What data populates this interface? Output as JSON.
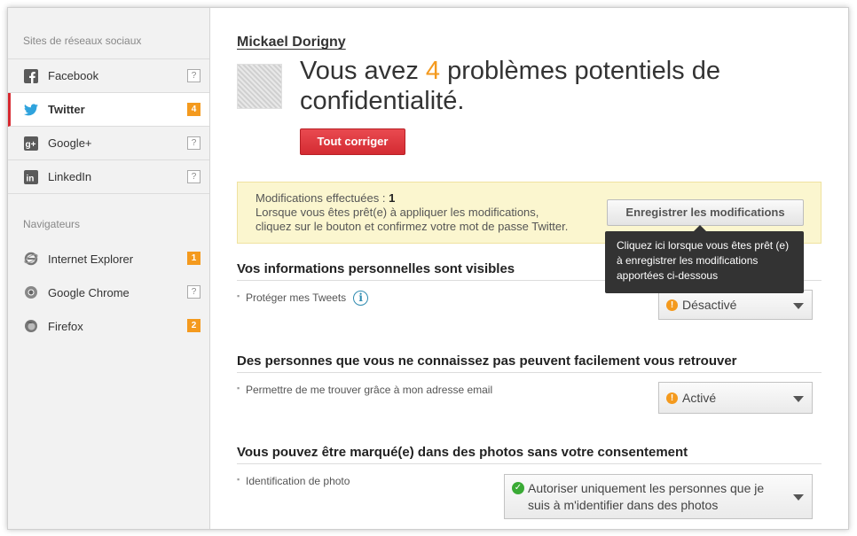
{
  "sidebar": {
    "social_heading": "Sites de réseaux sociaux",
    "social_items": [
      {
        "label": "Facebook",
        "badge": "?",
        "icon": "facebook-icon"
      },
      {
        "label": "Twitter",
        "badge": "4",
        "icon": "twitter-icon",
        "active": true
      },
      {
        "label": "Google+",
        "badge": "?",
        "icon": "google-plus-icon"
      },
      {
        "label": "LinkedIn",
        "badge": "?",
        "icon": "linkedin-icon"
      }
    ],
    "browser_heading": "Navigateurs",
    "browser_items": [
      {
        "label": "Internet Explorer",
        "badge": "1",
        "icon": "internet-explorer-icon"
      },
      {
        "label": "Google Chrome",
        "badge": "?",
        "icon": "google-chrome-icon"
      },
      {
        "label": "Firefox",
        "badge": "2",
        "icon": "firefox-icon"
      }
    ]
  },
  "header": {
    "user_name": "Mickael Dorigny",
    "headline_pre": "Vous avez ",
    "headline_count": "4",
    "headline_post": " problèmes potentiels de confidentialité.",
    "fix_all_label": "Tout corriger"
  },
  "notice": {
    "changes_label": "Modifications effectuées : ",
    "changes_count": "1",
    "line2": "Lorsque vous êtes prêt(e) à appliquer les modifications,",
    "line3": "cliquez sur le bouton et confirmez votre mot de passe Twitter.",
    "save_label": "Enregistrer les modifications",
    "tooltip": "Cliquez ici lorsque vous êtes prêt (e) à enregistrer les modifications apportées ci-dessous"
  },
  "sections": [
    {
      "title": "Vos informations personnelles sont visibles",
      "setting": "Protéger mes Tweets",
      "value": "Désactivé",
      "status": "warning"
    },
    {
      "title": "Des personnes que vous ne connaissez pas peuvent facilement vous retrouver",
      "setting": "Permettre de me trouver grâce à mon adresse email",
      "value": "Activé",
      "status": "warning"
    },
    {
      "title": "Vous pouvez être marqué(e) dans des photos sans votre consentement",
      "setting": "Identification de photo",
      "value": "Autoriser uniquement les personnes que je suis à m'identifier dans des photos",
      "status": "ok"
    }
  ],
  "colors": {
    "accent": "#f49a1e",
    "active_border": "#d7282f",
    "fix_button": "#d42b32",
    "notice_bg": "#fbf6cf",
    "ok": "#3aaa35"
  }
}
